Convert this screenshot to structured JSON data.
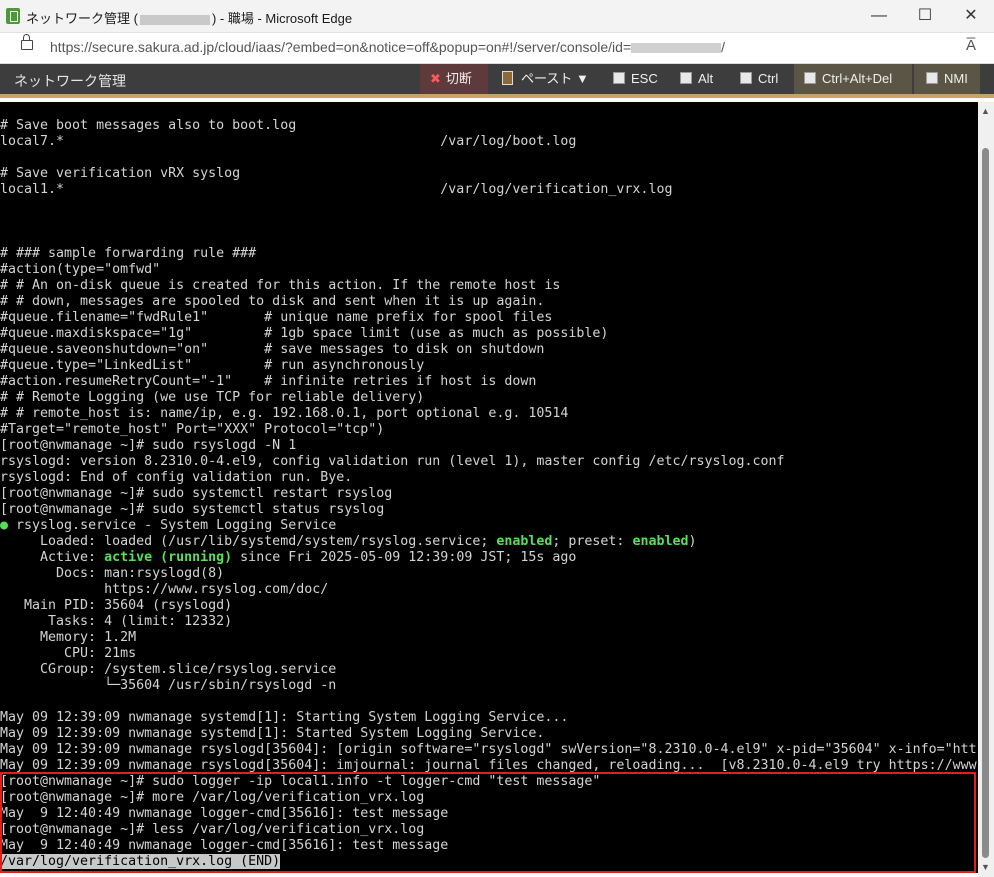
{
  "window": {
    "title_prefix": "ネットワーク管理 (",
    "title_suffix": ") - 職場 - Microsoft Edge",
    "minimize": "—",
    "maximize": "☐",
    "close": "✕"
  },
  "address": {
    "url_prefix": "https://secure.sakura.ad.jp/cloud/iaas/?embed=on&notice=off&popup=on#!/server/console/id=",
    "url_suffix": "/",
    "read_aloud": "A̅"
  },
  "toolbar": {
    "title": "ネットワーク管理",
    "disconnect": "切断",
    "paste": "ペースト ▼",
    "esc": "ESC",
    "alt": "Alt",
    "ctrl": "Ctrl",
    "ctrl_alt_del": "Ctrl+Alt+Del",
    "nmi": "NMI"
  },
  "terminal": {
    "lines": [
      "",
      "# Save boot messages also to boot.log",
      "local7.*                                               /var/log/boot.log",
      "",
      "# Save verification vRX syslog",
      "local1.*                                               /var/log/verification_vrx.log",
      "",
      "",
      "",
      "# ### sample forwarding rule ###",
      "#action(type=\"omfwd\"",
      "# # An on-disk queue is created for this action. If the remote host is",
      "# # down, messages are spooled to disk and sent when it is up again.",
      "#queue.filename=\"fwdRule1\"       # unique name prefix for spool files",
      "#queue.maxdiskspace=\"1g\"         # 1gb space limit (use as much as possible)",
      "#queue.saveonshutdown=\"on\"       # save messages to disk on shutdown",
      "#queue.type=\"LinkedList\"         # run asynchronously",
      "#action.resumeRetryCount=\"-1\"    # infinite retries if host is down",
      "# # Remote Logging (we use TCP for reliable delivery)",
      "# # remote_host is: name/ip, e.g. 192.168.0.1, port optional e.g. 10514",
      "#Target=\"remote_host\" Port=\"XXX\" Protocol=\"tcp\")",
      "[root@nwmanage ~]# sudo rsyslogd -N 1",
      "rsyslogd: version 8.2310.0-4.el9, config validation run (level 1), master config /etc/rsyslog.conf",
      "rsyslogd: End of config validation run. Bye.",
      "[root@nwmanage ~]# sudo systemctl restart rsyslog",
      "[root@nwmanage ~]# sudo systemctl status rsyslog"
    ],
    "status_dot": "●",
    "service_line": " rsyslog.service - System Logging Service",
    "loaded_prefix": "     Loaded: loaded (/usr/lib/systemd/system/rsyslog.service; ",
    "enabled1": "enabled",
    "loaded_mid": "; preset: ",
    "enabled2": "enabled",
    "loaded_suffix": ")",
    "active_prefix": "     Active: ",
    "active_state": "active (running)",
    "active_suffix": " since Fri 2025-05-09 12:39:09 JST; 15s ago",
    "status_lines": [
      "       Docs: man:rsyslogd(8)",
      "             https://www.rsyslog.com/doc/",
      "   Main PID: 35604 (rsyslogd)",
      "      Tasks: 4 (limit: 12332)",
      "     Memory: 1.2M",
      "        CPU: 21ms",
      "     CGroup: /system.slice/rsyslog.service",
      "             └─35604 /usr/sbin/rsyslogd -n",
      "",
      "May 09 12:39:09 nwmanage systemd[1]: Starting System Logging Service...",
      "May 09 12:39:09 nwmanage systemd[1]: Started System Logging Service.",
      "May 09 12:39:09 nwmanage rsyslogd[35604]: [origin software=\"rsyslogd\" swVersion=\"8.2310.0-4.el9\" x-pid=\"35604\" x-info=\"htt",
      "May 09 12:39:09 nwmanage rsyslogd[35604]: imjournal: journal files changed, reloading...  [v8.2310.0-4.el9 try https://www",
      "[root@nwmanage ~]# sudo logger -ip local1.info -t logger-cmd \"test message\"",
      "[root@nwmanage ~]# more /var/log/verification_vrx.log",
      "May  9 12:40:49 nwmanage logger-cmd[35616]: test message",
      "[root@nwmanage ~]# less /var/log/verification_vrx.log",
      "May  9 12:40:49 nwmanage logger-cmd[35616]: test message"
    ],
    "less_status": "/var/log/verification_vrx.log (END)"
  }
}
